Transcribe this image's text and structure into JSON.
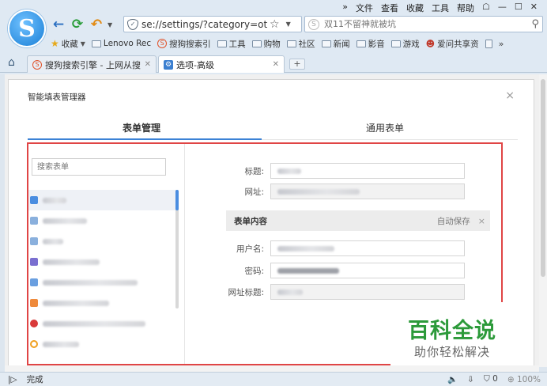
{
  "browser": {
    "logo_letter": "S",
    "menu": [
      "»",
      "文件",
      "查看",
      "收藏",
      "工具",
      "帮助"
    ],
    "window_buttons": [
      "☖",
      "—",
      "☐",
      "✕"
    ],
    "address": "se://settings/?category=oth",
    "search_placeholder": "双11不留神就被坑",
    "search_badge": "S",
    "favorites": [
      {
        "label": "收藏",
        "type": "star"
      },
      {
        "label": "Lenovo Rec",
        "type": "folder"
      },
      {
        "label": "搜狗搜索引",
        "type": "sogou"
      },
      {
        "label": "工具",
        "type": "folder"
      },
      {
        "label": "购物",
        "type": "folder"
      },
      {
        "label": "社区",
        "type": "folder"
      },
      {
        "label": "新闻",
        "type": "folder"
      },
      {
        "label": "影音",
        "type": "folder"
      },
      {
        "label": "游戏",
        "type": "folder"
      },
      {
        "label": "爱问共享资",
        "type": "user"
      }
    ],
    "favorites_more": "»",
    "tabs": [
      {
        "label": "搜狗搜索引擎 - 上网从搜",
        "active": false
      },
      {
        "label": "选项-高级",
        "active": true
      }
    ],
    "new_tab": "+"
  },
  "dialog": {
    "title": "智能填表管理器",
    "close": "×",
    "tabs": [
      "表单管理",
      "通用表单"
    ],
    "search_placeholder": "搜索表单",
    "list_icon_colors": [
      "#4a8de0",
      "#8ab0dd",
      "#8ab0dd",
      "#7a6fd0",
      "#6a9fe0",
      "#ef8a3c",
      "#d93a3a",
      "#f0a020"
    ],
    "fields": {
      "title_label": "标题:",
      "url_label": "网址:",
      "section_title": "表单内容",
      "autosave": "自动保存",
      "section_close": "×",
      "username_label": "用户名:",
      "password_label": "密码:",
      "url_title_label": "网址标题:"
    }
  },
  "watermark": {
    "big": "百科全说",
    "small": "助你轻松解决"
  },
  "status": {
    "text": "完成",
    "zoom": "100%",
    "count": "0"
  }
}
